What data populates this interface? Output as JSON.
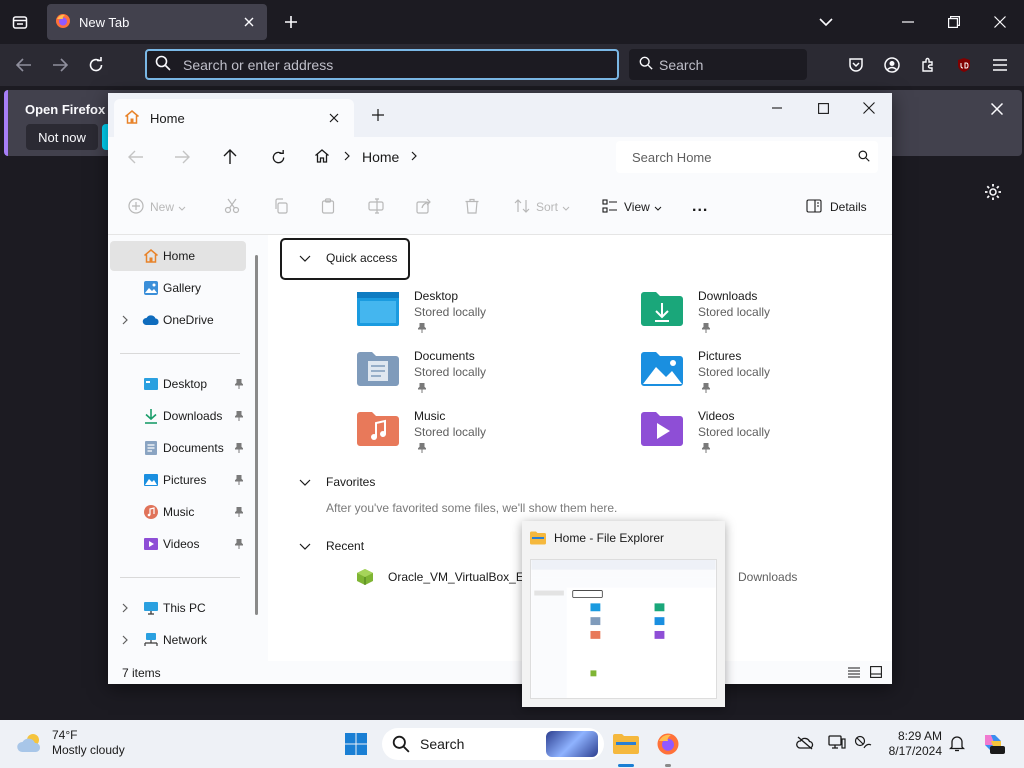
{
  "browser": {
    "tab_title": "New Tab",
    "url_placeholder": "Search or enter address",
    "search_placeholder": "Search",
    "notification": {
      "message": "Open Firefox ev",
      "not_now": "Not now"
    }
  },
  "explorer": {
    "tab_title": "Home",
    "breadcrumb": "Home",
    "search_placeholder": "Search Home",
    "commands": {
      "new": "New",
      "sort": "Sort",
      "view": "View",
      "more": "...",
      "details": "Details"
    },
    "nav": {
      "home": "Home",
      "gallery": "Gallery",
      "onedrive": "OneDrive",
      "desktop": "Desktop",
      "downloads": "Downloads",
      "documents": "Documents",
      "pictures": "Pictures",
      "music": "Music",
      "videos": "Videos",
      "this_pc": "This PC",
      "network": "Network"
    },
    "quick_access": {
      "title": "Quick access",
      "items": [
        {
          "name": "Desktop",
          "status": "Stored locally"
        },
        {
          "name": "Downloads",
          "status": "Stored locally"
        },
        {
          "name": "Documents",
          "status": "Stored locally"
        },
        {
          "name": "Pictures",
          "status": "Stored locally"
        },
        {
          "name": "Music",
          "status": "Stored locally"
        },
        {
          "name": "Videos",
          "status": "Stored locally"
        }
      ]
    },
    "favorites": {
      "title": "Favorites",
      "note": "After you've favorited some files, we'll show them here."
    },
    "recent": {
      "title": "Recent",
      "items": [
        {
          "name": "Oracle_VM_VirtualBox_Ext",
          "location": "Downloads"
        }
      ]
    },
    "status": "7 items"
  },
  "thumbnail": {
    "title": "Home - File Explorer"
  },
  "taskbar": {
    "weather_temp": "74°F",
    "weather_desc": "Mostly cloudy",
    "search_label": "Search",
    "time": "8:29 AM",
    "date": "8/17/2024"
  }
}
